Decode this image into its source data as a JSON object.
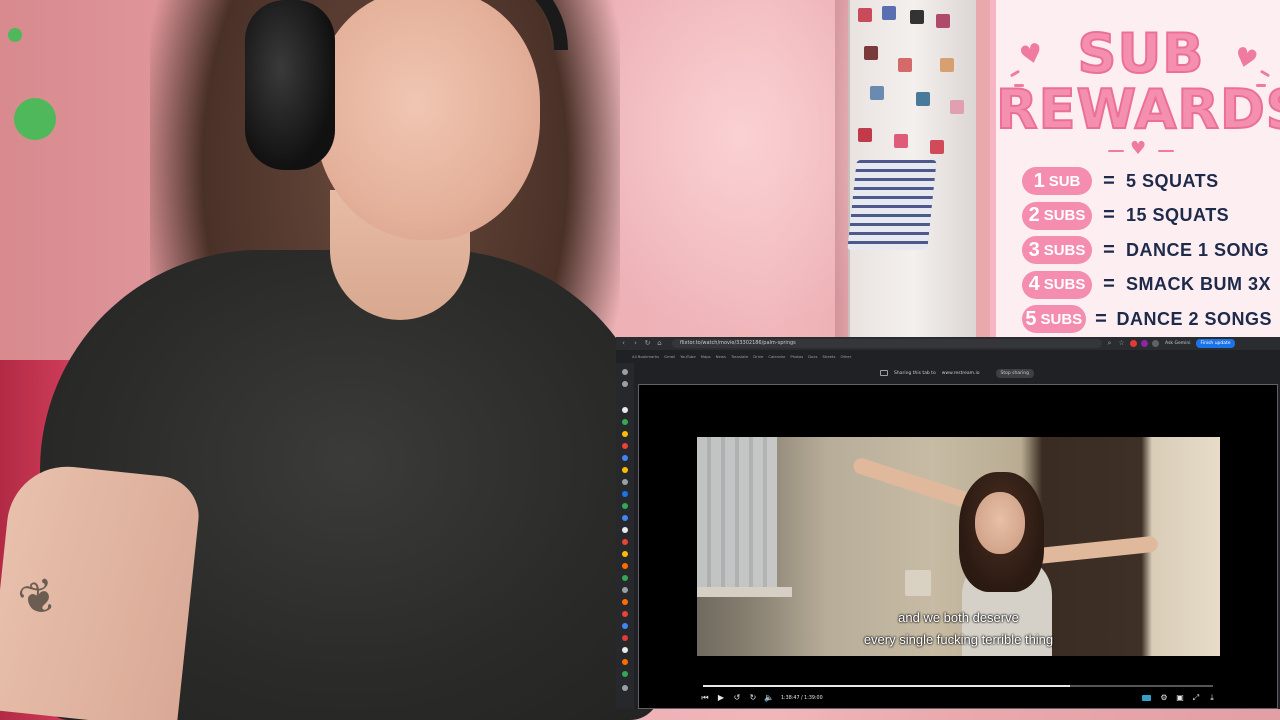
{
  "overlay": {
    "title_line1": "SUB",
    "title_line2": "REWARDS",
    "rows": [
      {
        "count": "1",
        "unit": "SUB",
        "equals": "=",
        "reward": "5 SQUATS"
      },
      {
        "count": "2",
        "unit": "SUBS",
        "equals": "=",
        "reward": "15 SQUATS"
      },
      {
        "count": "3",
        "unit": "SUBS",
        "equals": "=",
        "reward": "DANCE 1 SONG"
      },
      {
        "count": "4",
        "unit": "SUBS",
        "equals": "=",
        "reward": "SMACK BUM 3X"
      },
      {
        "count": "5",
        "unit": "SUBS",
        "equals": "=",
        "reward": "DANCE 2 SONGS"
      }
    ],
    "colors": {
      "pink": "#f48db0",
      "navy": "#1e2a4a",
      "bg": "#fdeef1"
    }
  },
  "browser": {
    "url": "flixtor.to/watch/movie/33302186/palm-springs",
    "ask_label": "Ask Gemini",
    "update_label": "Finish update",
    "sharing_text": "Sharing this tab to",
    "sharing_target": "www.restream.io",
    "stop_label": "Stop sharing",
    "bookmarks": [
      "All Bookmarks",
      "Gmail",
      "YouTube",
      "Maps",
      "News",
      "Translate",
      "Drive",
      "Calendar",
      "Photos",
      "Docs",
      "Sheets",
      "Other"
    ]
  },
  "player": {
    "subtitle_line1": "and we both deserve",
    "subtitle_line2": "every single fucking terrible thing",
    "time_display": "1:38:47 / 1:39:00",
    "progress_fraction": 0.72,
    "icons": [
      "prev-icon",
      "play-icon",
      "rewind-icon",
      "forward-icon",
      "volume-icon",
      "captions-icon",
      "settings-icon",
      "pip-icon",
      "fullscreen-icon",
      "download-icon"
    ]
  }
}
